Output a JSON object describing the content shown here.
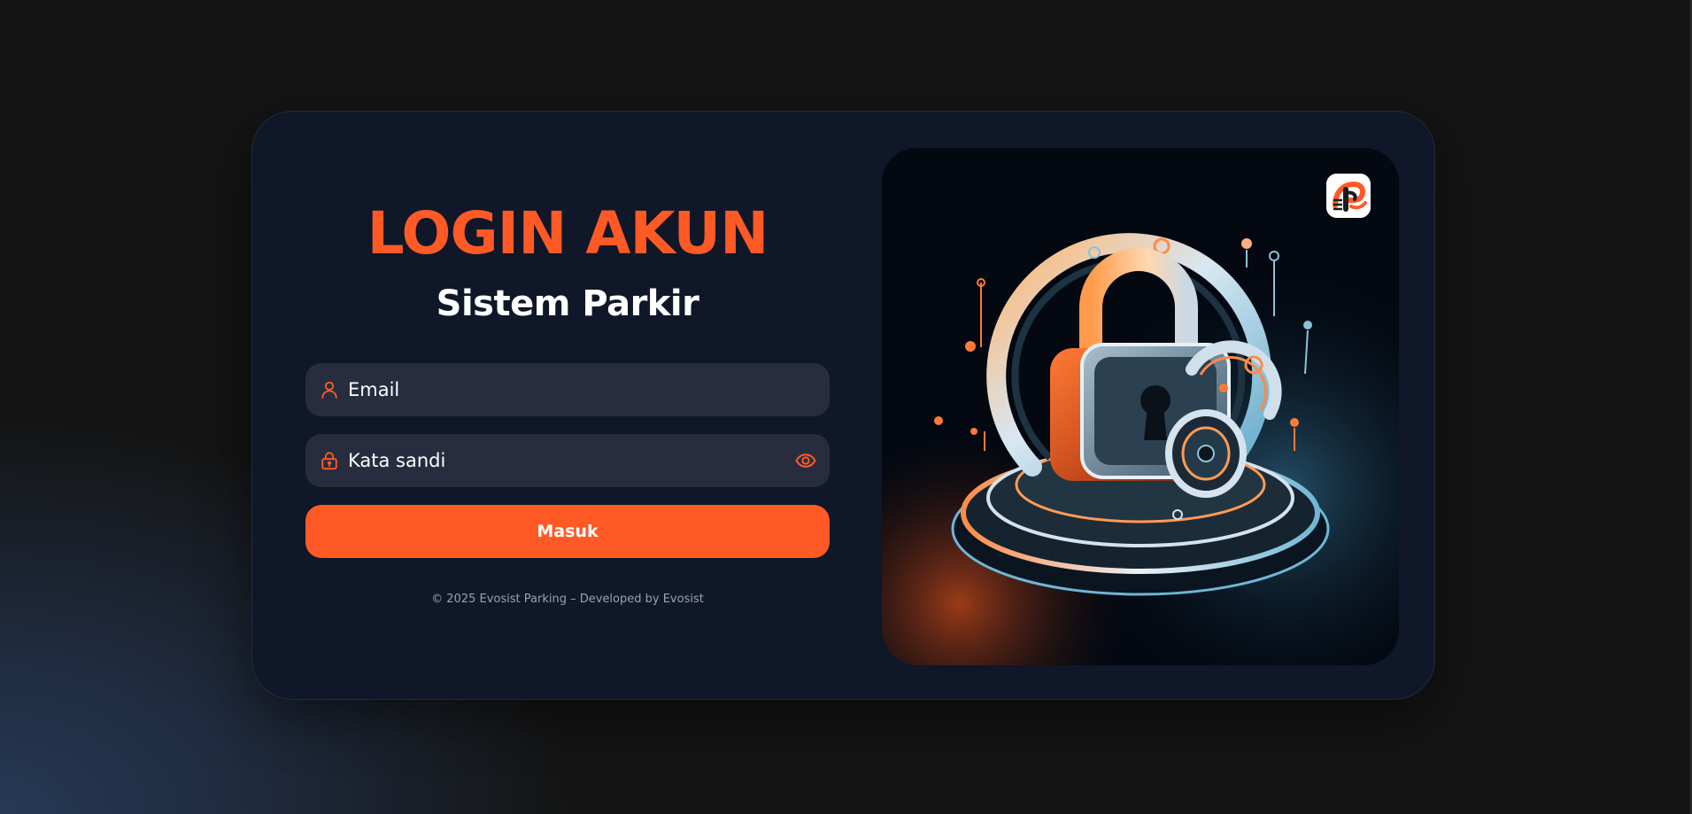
{
  "page": {
    "title": "LOGIN AKUN",
    "subtitle": "Sistem Parkir"
  },
  "form": {
    "email": {
      "placeholder": "Email",
      "value": "",
      "icon": "user-icon"
    },
    "password": {
      "placeholder": "Kata sandi",
      "value": "",
      "icon": "lock-icon",
      "toggle_icon": "eye-icon"
    },
    "submit_label": "Masuk"
  },
  "footer": {
    "text": "© 2025 Evosist Parking – Developed by Evosist"
  },
  "illustration": {
    "subject": "padlock-illustration",
    "brand_logo": "evosist-parking-logo"
  },
  "colors": {
    "accent": "#ff5a25",
    "card_background": "#0f1729",
    "field_background": "#272d3f",
    "page_background": "#141414",
    "footer_text": "#9aa3b5"
  }
}
